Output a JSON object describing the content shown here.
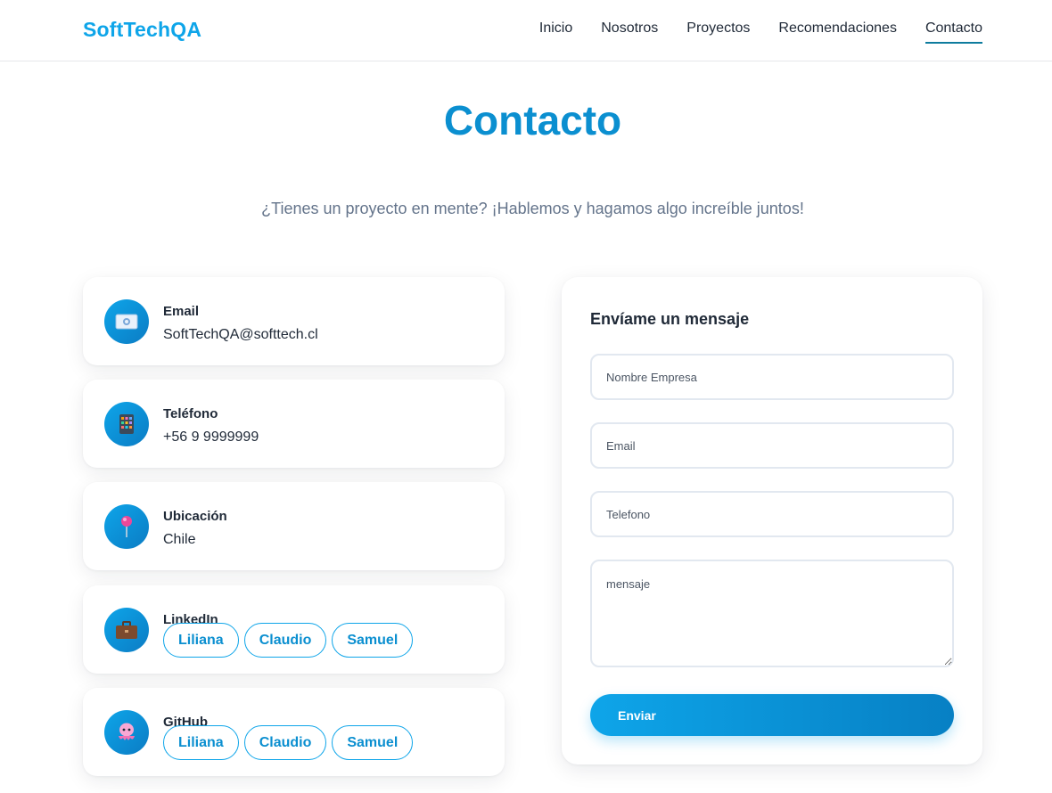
{
  "brand": "SoftTechQA",
  "nav": [
    "Inicio",
    "Nosotros",
    "Proyectos",
    "Recomendaciones",
    "Contacto"
  ],
  "active_nav": "Contacto",
  "page": {
    "title": "Contacto",
    "subtitle": "¿Tienes un proyecto en mente? ¡Hablemos y hagamos algo increíble juntos!"
  },
  "info_cards": [
    {
      "title": "Email",
      "value": "SoftTechQA@softtech.cl",
      "icon": "envelope-icon"
    },
    {
      "title": "Teléfono",
      "value": "+56 9 9999999",
      "icon": "phone-icon"
    },
    {
      "title": "Ubicación",
      "value": "Chile",
      "icon": "pin-icon"
    },
    {
      "title": "LinkedIn",
      "icon": "briefcase-icon",
      "people": [
        "Liliana",
        "Claudio",
        "Samuel"
      ]
    },
    {
      "title": "GitHub",
      "icon": "octopus-icon",
      "people": [
        "Liliana",
        "Claudio",
        "Samuel"
      ]
    }
  ],
  "form": {
    "title": "Envíame un mensaje",
    "company_placeholder": "Nombre Empresa",
    "email_placeholder": "Email",
    "phone_placeholder": "Telefono",
    "message_placeholder": "mensaje",
    "submit_label": "Enviar"
  },
  "colors": {
    "accent": "#0ea5e9",
    "title": "#0b8fd0",
    "text": "#1f2937",
    "muted": "#64748b"
  }
}
